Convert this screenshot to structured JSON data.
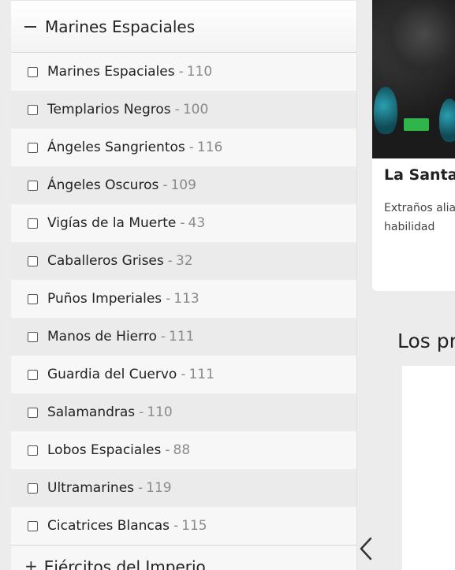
{
  "filter_group": {
    "title": "Marines Espaciales",
    "items": [
      {
        "name": "Marines Espaciales",
        "count": "110"
      },
      {
        "name": "Templarios Negros",
        "count": "100"
      },
      {
        "name": "Ángeles Sangrientos",
        "count": "116"
      },
      {
        "name": "Ángeles Oscuros",
        "count": "109"
      },
      {
        "name": "Vigías de la Muerte",
        "count": "43"
      },
      {
        "name": "Caballeros Grises",
        "count": "32"
      },
      {
        "name": "Puños Imperiales",
        "count": "113"
      },
      {
        "name": "Manos de Hierro",
        "count": "111"
      },
      {
        "name": "Guardia del Cuervo",
        "count": "111"
      },
      {
        "name": "Salamandras",
        "count": "110"
      },
      {
        "name": "Lobos Espaciales",
        "count": "88"
      },
      {
        "name": "Ultramarines",
        "count": "119"
      },
      {
        "name": "Cicatrices Blancas",
        "count": "115"
      }
    ],
    "separator": "-"
  },
  "next_group": {
    "icon": "+",
    "title": "Ejércitos del Imperio"
  },
  "article_card": {
    "title": "La Santa",
    "text_line1": "Extraños alia",
    "text_line2": "habilidad"
  },
  "section": {
    "title": "Los pr"
  },
  "icons": {
    "collapse": "minus-icon",
    "prev": "chevron-left-icon"
  }
}
